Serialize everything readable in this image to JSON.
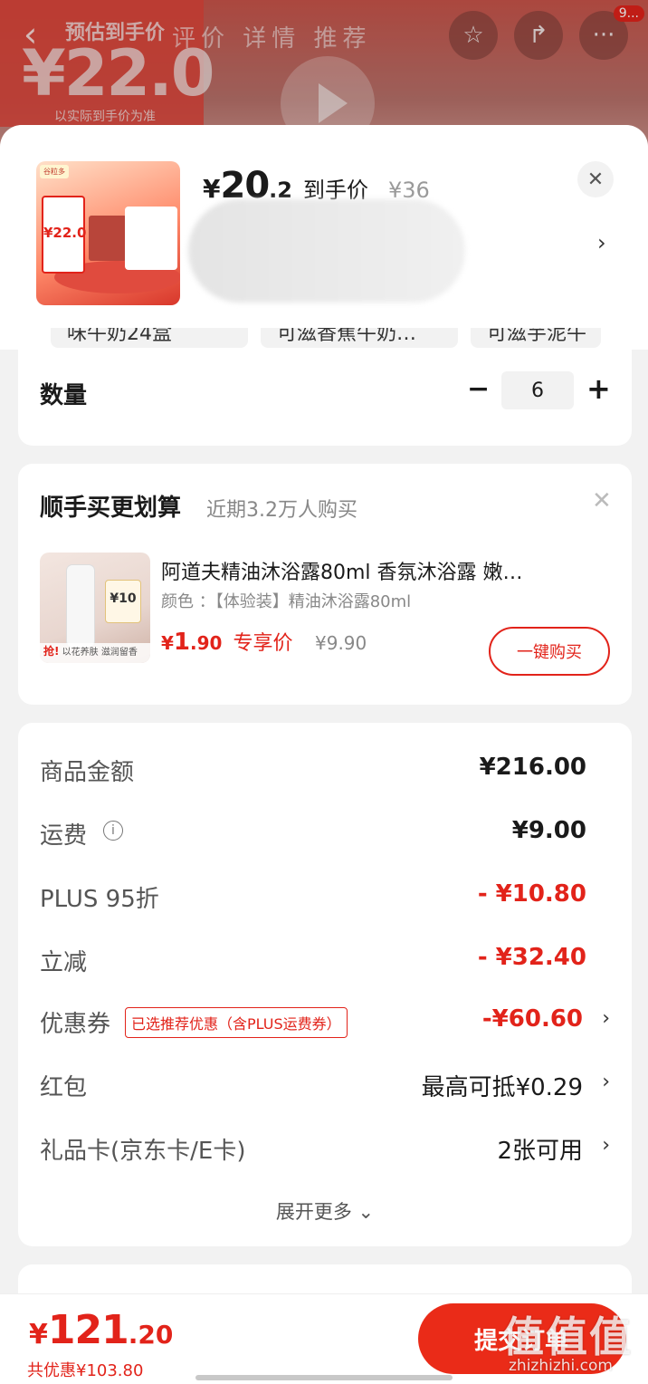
{
  "background": {
    "promo_line1": "预估到手价",
    "promo_price": "¥22.0",
    "promo_line3": "以实际到手价为准",
    "tabs_text": "评价 详情 推荐",
    "badge": "9..."
  },
  "sheet": {
    "price_symbol": "¥",
    "price_int": "20",
    "price_dec": ".2",
    "price_tag": "到手价",
    "original_price": "¥36",
    "chips": [
      "味牛奶24盒",
      "可滋香蕉牛奶…",
      "可滋芋泥牛"
    ],
    "quantity_label": "数量",
    "quantity_value": "6",
    "minus": "−",
    "plus": "+"
  },
  "recommend": {
    "title": "顺手买更划算",
    "subtitle": "近期3.2万人购买",
    "product_name": "阿道夫精油沐浴露80ml 香氛沐浴露 嫩…",
    "color_line": "颜色 ：【体验装】精油沐浴露80ml",
    "price_symbol": "¥",
    "price_int": "1",
    "price_dec": ".90",
    "price_label": "专享价",
    "original_price": "¥9.90",
    "buy_button": "一键购买",
    "thumb_coupon": "¥10",
    "thumb_tag_a": "抢!",
    "thumb_tag_b": "以花养肤 滋润留香"
  },
  "summary": {
    "rows": [
      {
        "label": "商品金额",
        "value": "¥216.00"
      },
      {
        "label": "运费",
        "value": "¥9.00"
      },
      {
        "label": "PLUS 95折",
        "value": "- ¥10.80"
      },
      {
        "label": "立减",
        "value": "- ¥32.40"
      },
      {
        "label": "优惠券",
        "tag": "已选推荐优惠（含PLUS运费券）",
        "value": "-¥60.60"
      },
      {
        "label": "红包",
        "value": "最高可抵¥0.29"
      },
      {
        "label": "礼品卡(京东卡/E卡)",
        "value": "2张可用"
      }
    ],
    "expand": "展开更多 ⌄"
  },
  "bottom": {
    "total_symbol": "¥",
    "total_int": "121",
    "total_dec": ".20",
    "saved": "共优惠¥103.80",
    "submit": "提交订单"
  },
  "watermark": {
    "main": "值值值",
    "sub": "zhizhizhi.com"
  },
  "colors": {
    "accent": "#e2231a",
    "submit_bg": "#ea2b18",
    "page_bg": "#f2f2f2"
  }
}
